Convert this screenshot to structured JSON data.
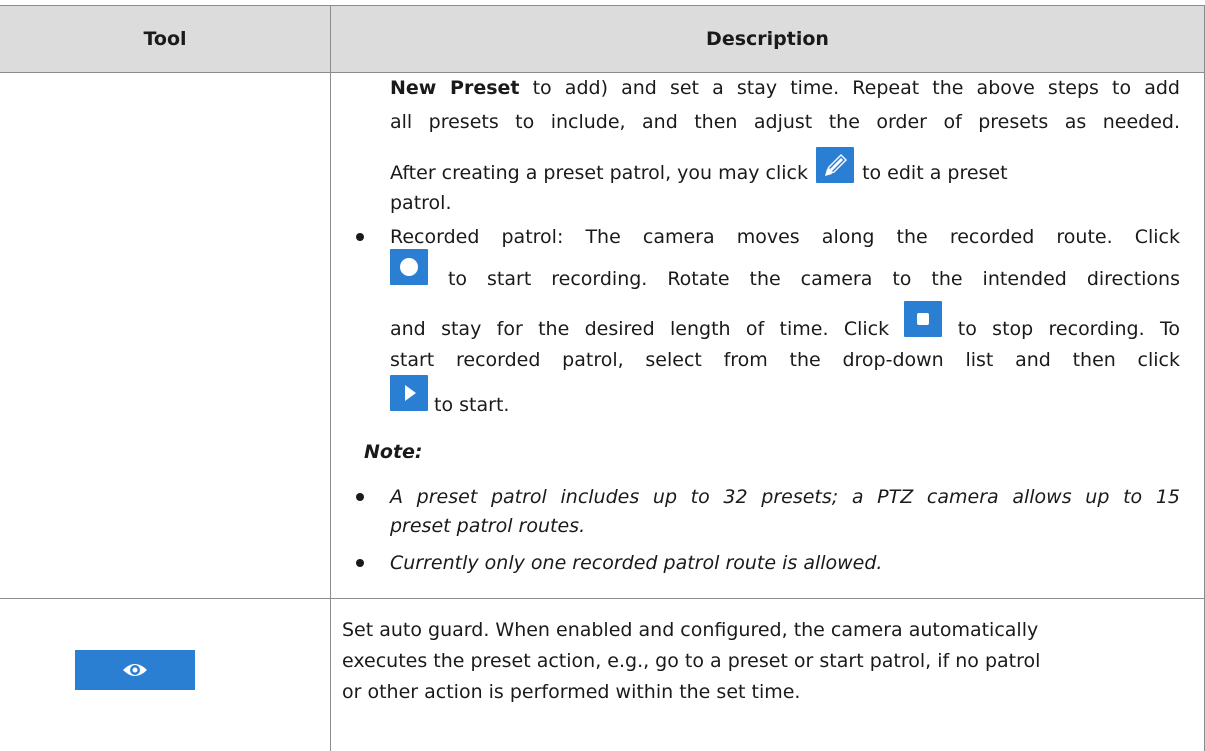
{
  "header": {
    "col_tool": "Tool",
    "col_description": "Description"
  },
  "rows": [
    {
      "lines": {
        "l1_bold": "New Preset",
        "l1_rest": " to add) and set a stay time. Repeat the above steps to add",
        "l2": "all presets to include, and then adjust the order of presets as needed.",
        "l3_before": "After creating a preset patrol, you may click ",
        "l3_after": " to edit a preset",
        "l4": "patrol.",
        "l5": "Recorded patrol: The camera moves along the recorded route. Click",
        "l6": " to start recording. Rotate the camera to the intended directions",
        "l7_before": "and stay for the desired length of time. Click ",
        "l7_after": " to stop recording. To",
        "l8": "start recorded patrol, select from the drop-down list and then click",
        "l9": " to start.",
        "note": "Note:",
        "n1a": "A preset patrol includes up to 32 presets; a PTZ camera allows up to 15",
        "n1b": "preset patrol routes.",
        "n2": "Currently only one recorded patrol route is allowed."
      }
    },
    {
      "tool_icon": "eye-icon",
      "d1": "Set auto guard. When enabled and configured, the camera automatically",
      "d2": "executes the preset action, e.g., go to a preset or start patrol, if no patrol",
      "d3": "or other action is performed within the set time."
    }
  ],
  "colors": {
    "header_bg": "#dcdcdc",
    "icon_blue": "#2b7fd3",
    "border": "#8c8c8c"
  }
}
